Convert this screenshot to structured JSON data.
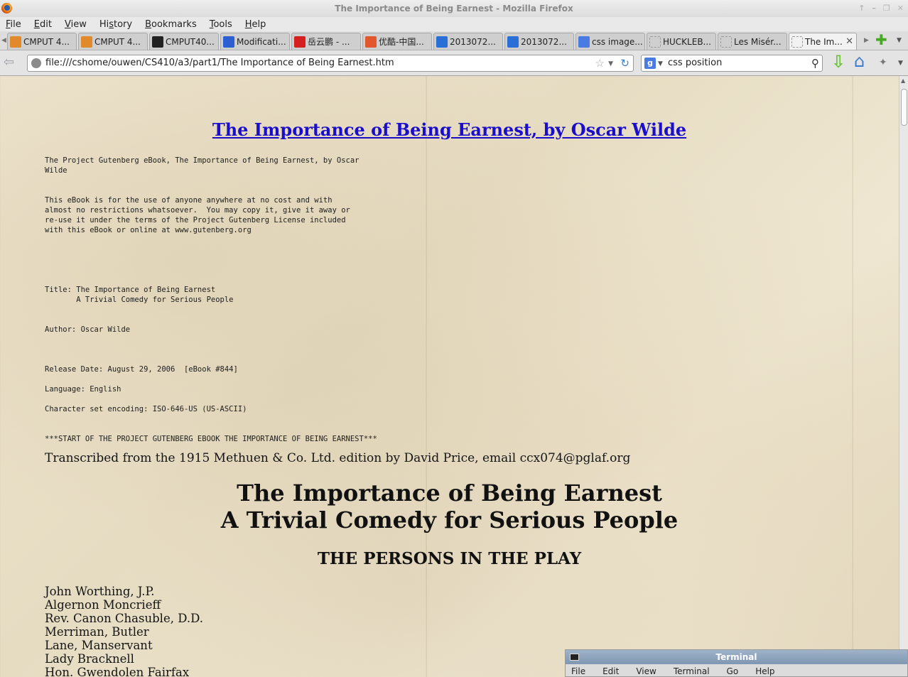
{
  "window": {
    "title": "The Importance of Being Earnest - Mozilla Firefox"
  },
  "menubar": {
    "items": [
      {
        "label": "File",
        "key": "F"
      },
      {
        "label": "Edit",
        "key": "E"
      },
      {
        "label": "View",
        "key": "V"
      },
      {
        "label": "History",
        "key": "s"
      },
      {
        "label": "Bookmarks",
        "key": "B"
      },
      {
        "label": "Tools",
        "key": "T"
      },
      {
        "label": "Help",
        "key": "H"
      }
    ]
  },
  "tabs": [
    {
      "label": "CMPUT 4...",
      "icon": "moodle-icon",
      "color": "#e08a2c"
    },
    {
      "label": "CMPUT 4...",
      "icon": "moodle-icon",
      "color": "#e08a2c"
    },
    {
      "label": "CMPUT40...",
      "icon": "github-icon",
      "color": "#222222"
    },
    {
      "label": "Modificati...",
      "icon": "baidu-icon",
      "color": "#2d5fd3"
    },
    {
      "label": "岳云鹏 - ...",
      "icon": "s6-icon",
      "color": "#d42020"
    },
    {
      "label": "优酷-中国...",
      "icon": "youku-icon",
      "color": "#e0582c"
    },
    {
      "label": "2013072...",
      "icon": "play-icon",
      "color": "#2a6fd6"
    },
    {
      "label": "2013072...",
      "icon": "play-icon",
      "color": "#2a6fd6"
    },
    {
      "label": "css image...",
      "icon": "google-icon",
      "color": "#4a7be0"
    },
    {
      "label": "HUCKLEB...",
      "icon": "page-icon",
      "color": "#bbbbbb"
    },
    {
      "label": "Les Misér...",
      "icon": "page-icon",
      "color": "#bbbbbb"
    },
    {
      "label": "The Im...",
      "icon": "page-icon",
      "color": "#bbbbbb",
      "active": true
    }
  ],
  "navbar": {
    "url": "file:///cshome/ouwen/CS410/a3/part1/The Importance of Being Earnest.htm",
    "search_value": "css position",
    "search_engine": "g"
  },
  "document": {
    "title": "The Importance of Being Earnest, by Oscar Wilde",
    "intro": "The Project Gutenberg eBook, The Importance of Being Earnest, by Oscar\nWilde",
    "license": "This eBook is for the use of anyone anywhere at no cost and with\nalmost no restrictions whatsoever.  You may copy it, give it away or\nre-use it under the terms of the Project Gutenberg License included\nwith this eBook or online at www.gutenberg.org",
    "title_block": "Title: The Importance of Being Earnest\n       A Trivial Comedy for Serious People",
    "author": "Author: Oscar Wilde",
    "release": "Release Date: August 29, 2006  [eBook #844]",
    "language": "Language: English",
    "charset": "Character set encoding: ISO-646-US (US-ASCII)",
    "start_marker": "***START OF THE PROJECT GUTENBERG EBOOK THE IMPORTANCE OF BEING EARNEST***",
    "transcribed": "Transcribed from the 1915 Methuen & Co. Ltd. edition by David Price, email ccx074@pglaf.org",
    "heading_line1": "The Importance of Being Earnest",
    "heading_line2": "A Trivial Comedy for Serious People",
    "persons_heading": "THE PERSONS IN THE PLAY",
    "persons": [
      "John Worthing, J.P.",
      "Algernon Moncrieff",
      "Rev. Canon Chasuble, D.D.",
      "Merriman, Butler",
      "Lane, Manservant",
      "Lady Bracknell",
      "Hon. Gwendolen Fairfax"
    ]
  },
  "terminal": {
    "title": "Terminal",
    "menu": [
      "File",
      "Edit",
      "View",
      "Terminal",
      "Go",
      "Help"
    ]
  }
}
